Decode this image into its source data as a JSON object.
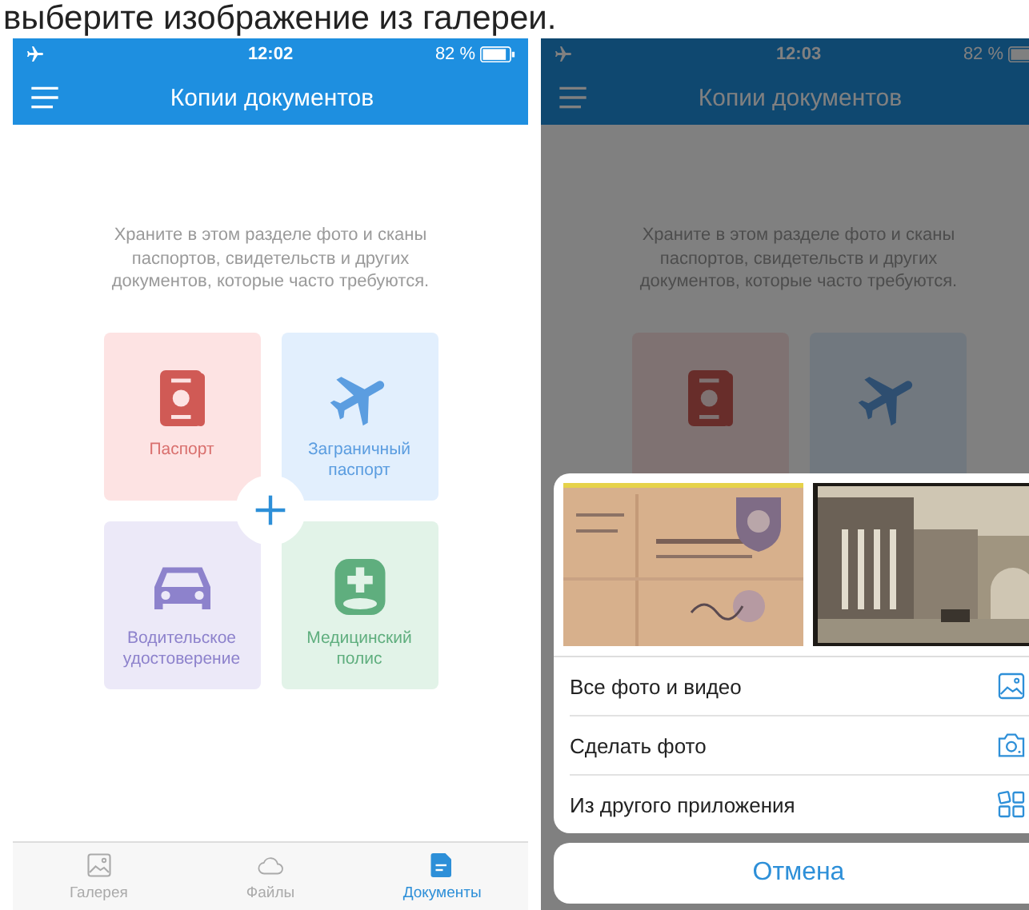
{
  "caption": "выберите изображение из галереи.",
  "phones": [
    {
      "dimmed": false,
      "status": {
        "time": "12:02",
        "battery": "82 %"
      },
      "title": "Копии документов",
      "description": "Храните в этом разделе фото и сканы паспортов, свидетельств и других документов, которые часто требуются.",
      "tiles": [
        {
          "kind": "passport",
          "label": "Паспорт"
        },
        {
          "kind": "plane",
          "label": "Заграничный паспорт"
        },
        {
          "kind": "car",
          "label": "Водительское удостоверение"
        },
        {
          "kind": "medical",
          "label": "Медицинский полис"
        }
      ],
      "add_button": true,
      "tab_bar": [
        {
          "kind": "gallery",
          "label": "Галерея",
          "selected": false
        },
        {
          "kind": "cloud",
          "label": "Файлы",
          "selected": false
        },
        {
          "kind": "document",
          "label": "Документы",
          "selected": true
        }
      ]
    },
    {
      "dimmed": true,
      "status": {
        "time": "12:03",
        "battery": "82 %"
      },
      "title": "Копии документов",
      "description": "Храните в этом разделе фото и сканы паспортов, свидетельств и других документов, которые часто требуются.",
      "tiles": [
        {
          "kind": "passport"
        },
        {
          "kind": "plane"
        }
      ],
      "action_sheet": {
        "items": [
          {
            "kind": "gallery",
            "label": "Все фото и видео"
          },
          {
            "kind": "camera",
            "label": "Сделать фото"
          },
          {
            "kind": "apps",
            "label": "Из другого приложения"
          }
        ],
        "cancel": "Отмена"
      }
    }
  ]
}
